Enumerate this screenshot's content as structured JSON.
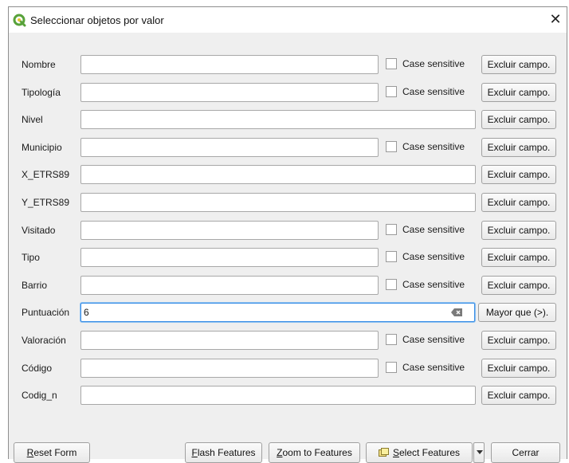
{
  "window": {
    "title": "Seleccionar objetos por valor",
    "close_glyph": "✕",
    "app_icon": "qgis-icon",
    "accent": "#3a8ee6"
  },
  "fields": [
    {
      "label": "Nombre",
      "value": "",
      "case_sensitive": true,
      "case_label": "Case sensitive",
      "operator": "Excluir campo."
    },
    {
      "label": "Tipología",
      "value": "",
      "case_sensitive": true,
      "case_label": "Case sensitive",
      "operator": "Excluir campo."
    },
    {
      "label": "Nivel",
      "value": "",
      "case_sensitive": false,
      "operator": "Excluir campo."
    },
    {
      "label": "Municipio",
      "value": "",
      "case_sensitive": true,
      "case_label": "Case sensitive",
      "operator": "Excluir campo."
    },
    {
      "label": "X_ETRS89",
      "value": "",
      "case_sensitive": false,
      "operator": "Excluir campo."
    },
    {
      "label": "Y_ETRS89",
      "value": "",
      "case_sensitive": false,
      "operator": "Excluir campo."
    },
    {
      "label": "Visitado",
      "value": "",
      "case_sensitive": true,
      "case_label": "Case sensitive",
      "operator": "Excluir campo."
    },
    {
      "label": "Tipo",
      "value": "",
      "case_sensitive": true,
      "case_label": "Case sensitive",
      "operator": "Excluir campo."
    },
    {
      "label": "Barrio",
      "value": "",
      "case_sensitive": true,
      "case_label": "Case sensitive",
      "operator": "Excluir campo."
    },
    {
      "label": "Puntuación",
      "value": "6",
      "case_sensitive": false,
      "focused": true,
      "operator": "Mayor que (>)."
    },
    {
      "label": "Valoración",
      "value": "",
      "case_sensitive": true,
      "case_label": "Case sensitive",
      "operator": "Excluir campo."
    },
    {
      "label": "Código",
      "value": "",
      "case_sensitive": true,
      "case_label": "Case sensitive",
      "operator": "Excluir campo."
    },
    {
      "label": "Codig_n",
      "value": "",
      "case_sensitive": false,
      "operator": "Excluir campo."
    }
  ],
  "buttons": {
    "reset": {
      "mnemonic": "R",
      "rest": "eset Form"
    },
    "flash": {
      "mnemonic": "F",
      "rest": "lash Features"
    },
    "zoom": {
      "mnemonic": "Z",
      "rest": "oom to Features"
    },
    "select": {
      "mnemonic": "S",
      "rest": "elect Features"
    },
    "close": "Cerrar"
  }
}
